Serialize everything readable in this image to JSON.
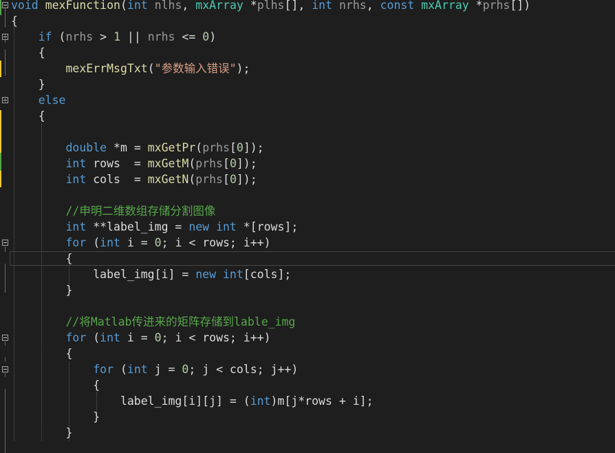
{
  "editor": {
    "colors": {
      "background": "#1e1e1e",
      "keyword": "#569cd6",
      "type": "#4ec9b0",
      "function": "#dcdcaa",
      "parameter": "#9a9a9a",
      "string": "#d69d85",
      "number": "#b5cea8",
      "comment": "#57a64a",
      "text": "#dcdcdc",
      "change_saved": "#57a64a",
      "change_unsaved": "#efc832"
    },
    "lines": [
      {
        "role": "function-signature",
        "tokens": [
          {
            "c": "kw",
            "t": "void"
          },
          {
            "c": "tx",
            "t": " "
          },
          {
            "c": "fn",
            "t": "mexFunction"
          },
          {
            "c": "tx",
            "t": "("
          },
          {
            "c": "kw",
            "t": "int"
          },
          {
            "c": "tx",
            "t": " "
          },
          {
            "c": "pm",
            "t": "nlhs"
          },
          {
            "c": "tx",
            "t": ", "
          },
          {
            "c": "ty",
            "t": "mxArray"
          },
          {
            "c": "tx",
            "t": " *"
          },
          {
            "c": "pm",
            "t": "plhs"
          },
          {
            "c": "tx",
            "t": "[], "
          },
          {
            "c": "kw",
            "t": "int"
          },
          {
            "c": "tx",
            "t": " "
          },
          {
            "c": "pm",
            "t": "nrhs"
          },
          {
            "c": "tx",
            "t": ", "
          },
          {
            "c": "kw",
            "t": "const"
          },
          {
            "c": "tx",
            "t": " "
          },
          {
            "c": "ty",
            "t": "mxArray"
          },
          {
            "c": "tx",
            "t": " *"
          },
          {
            "c": "pm",
            "t": "prhs"
          },
          {
            "c": "tx",
            "t": "[])"
          }
        ]
      },
      {
        "role": "brace",
        "tokens": [
          {
            "c": "tx",
            "t": "{"
          }
        ]
      },
      {
        "role": "if-statement",
        "tokens": [
          {
            "c": "tx",
            "t": "    "
          },
          {
            "c": "kw",
            "t": "if"
          },
          {
            "c": "tx",
            "t": " ("
          },
          {
            "c": "pm",
            "t": "nrhs"
          },
          {
            "c": "tx",
            "t": " > "
          },
          {
            "c": "num",
            "t": "1"
          },
          {
            "c": "tx",
            "t": " || "
          },
          {
            "c": "pm",
            "t": "nrhs"
          },
          {
            "c": "tx",
            "t": " <= "
          },
          {
            "c": "num",
            "t": "0"
          },
          {
            "c": "tx",
            "t": ")"
          }
        ]
      },
      {
        "role": "brace",
        "tokens": [
          {
            "c": "tx",
            "t": "    {"
          }
        ]
      },
      {
        "role": "statement",
        "tokens": [
          {
            "c": "tx",
            "t": "        "
          },
          {
            "c": "fn",
            "t": "mexErrMsgTxt"
          },
          {
            "c": "tx",
            "t": "("
          },
          {
            "c": "str",
            "t": "\"参数输入错误\""
          },
          {
            "c": "tx",
            "t": ");"
          }
        ]
      },
      {
        "role": "brace",
        "tokens": [
          {
            "c": "tx",
            "t": "    }"
          }
        ]
      },
      {
        "role": "else-statement",
        "tokens": [
          {
            "c": "tx",
            "t": "    "
          },
          {
            "c": "kw",
            "t": "else"
          }
        ]
      },
      {
        "role": "brace",
        "tokens": [
          {
            "c": "tx",
            "t": "    {"
          }
        ]
      },
      {
        "role": "blank",
        "tokens": []
      },
      {
        "role": "declaration",
        "tokens": [
          {
            "c": "tx",
            "t": "        "
          },
          {
            "c": "kw",
            "t": "double"
          },
          {
            "c": "tx",
            "t": " *m = "
          },
          {
            "c": "fn",
            "t": "mxGetPr"
          },
          {
            "c": "tx",
            "t": "("
          },
          {
            "c": "pm",
            "t": "prhs"
          },
          {
            "c": "tx",
            "t": "["
          },
          {
            "c": "num",
            "t": "0"
          },
          {
            "c": "tx",
            "t": "]);"
          }
        ]
      },
      {
        "role": "declaration",
        "tokens": [
          {
            "c": "tx",
            "t": "        "
          },
          {
            "c": "kw",
            "t": "int"
          },
          {
            "c": "tx",
            "t": " rows  = "
          },
          {
            "c": "fn",
            "t": "mxGetM"
          },
          {
            "c": "tx",
            "t": "("
          },
          {
            "c": "pm",
            "t": "prhs"
          },
          {
            "c": "tx",
            "t": "["
          },
          {
            "c": "num",
            "t": "0"
          },
          {
            "c": "tx",
            "t": "]);"
          }
        ]
      },
      {
        "role": "declaration",
        "tokens": [
          {
            "c": "tx",
            "t": "        "
          },
          {
            "c": "kw",
            "t": "int"
          },
          {
            "c": "tx",
            "t": " cols  = "
          },
          {
            "c": "fn",
            "t": "mxGetN"
          },
          {
            "c": "tx",
            "t": "("
          },
          {
            "c": "pm",
            "t": "prhs"
          },
          {
            "c": "tx",
            "t": "["
          },
          {
            "c": "num",
            "t": "0"
          },
          {
            "c": "tx",
            "t": "]);"
          }
        ]
      },
      {
        "role": "blank",
        "tokens": []
      },
      {
        "role": "comment",
        "tokens": [
          {
            "c": "tx",
            "t": "        "
          },
          {
            "c": "cm",
            "t": "//申明二维数组存储分割图像"
          }
        ]
      },
      {
        "role": "declaration",
        "tokens": [
          {
            "c": "tx",
            "t": "        "
          },
          {
            "c": "kw",
            "t": "int"
          },
          {
            "c": "tx",
            "t": " **label_img = "
          },
          {
            "c": "kw",
            "t": "new"
          },
          {
            "c": "tx",
            "t": " "
          },
          {
            "c": "kw",
            "t": "int"
          },
          {
            "c": "tx",
            "t": " *[rows];"
          }
        ]
      },
      {
        "role": "for-loop",
        "tokens": [
          {
            "c": "tx",
            "t": "        "
          },
          {
            "c": "kw",
            "t": "for"
          },
          {
            "c": "tx",
            "t": " ("
          },
          {
            "c": "kw",
            "t": "int"
          },
          {
            "c": "tx",
            "t": " i = "
          },
          {
            "c": "num",
            "t": "0"
          },
          {
            "c": "tx",
            "t": "; i < rows; i++)"
          }
        ]
      },
      {
        "role": "brace",
        "tokens": [
          {
            "c": "tx",
            "t": "        {"
          }
        ]
      },
      {
        "role": "statement",
        "tokens": [
          {
            "c": "tx",
            "t": "            label_img[i] = "
          },
          {
            "c": "kw",
            "t": "new"
          },
          {
            "c": "tx",
            "t": " "
          },
          {
            "c": "kw",
            "t": "int"
          },
          {
            "c": "tx",
            "t": "[cols];"
          }
        ]
      },
      {
        "role": "brace",
        "tokens": [
          {
            "c": "tx",
            "t": "        }"
          }
        ]
      },
      {
        "role": "blank",
        "tokens": []
      },
      {
        "role": "comment",
        "tokens": [
          {
            "c": "tx",
            "t": "        "
          },
          {
            "c": "cm",
            "t": "//将Matlab传进来的矩阵存储到lable_img"
          }
        ]
      },
      {
        "role": "for-loop",
        "tokens": [
          {
            "c": "tx",
            "t": "        "
          },
          {
            "c": "kw",
            "t": "for"
          },
          {
            "c": "tx",
            "t": " ("
          },
          {
            "c": "kw",
            "t": "int"
          },
          {
            "c": "tx",
            "t": " i = "
          },
          {
            "c": "num",
            "t": "0"
          },
          {
            "c": "tx",
            "t": "; i < rows; i++)"
          }
        ]
      },
      {
        "role": "brace",
        "tokens": [
          {
            "c": "tx",
            "t": "        {"
          }
        ]
      },
      {
        "role": "for-loop",
        "tokens": [
          {
            "c": "tx",
            "t": "            "
          },
          {
            "c": "kw",
            "t": "for"
          },
          {
            "c": "tx",
            "t": " ("
          },
          {
            "c": "kw",
            "t": "int"
          },
          {
            "c": "tx",
            "t": " j = "
          },
          {
            "c": "num",
            "t": "0"
          },
          {
            "c": "tx",
            "t": "; j < cols; j++)"
          }
        ]
      },
      {
        "role": "brace",
        "tokens": [
          {
            "c": "tx",
            "t": "            {"
          }
        ]
      },
      {
        "role": "statement",
        "tokens": [
          {
            "c": "tx",
            "t": "                label_img[i][j] = ("
          },
          {
            "c": "kw",
            "t": "int"
          },
          {
            "c": "tx",
            "t": ")m[j*rows + i];"
          }
        ]
      },
      {
        "role": "brace",
        "tokens": [
          {
            "c": "tx",
            "t": "            }"
          }
        ]
      },
      {
        "role": "brace",
        "tokens": [
          {
            "c": "tx",
            "t": "        }"
          }
        ]
      },
      {
        "role": "blank",
        "tokens": []
      }
    ],
    "fold_markers": [
      0,
      2,
      6,
      15,
      21,
      23
    ],
    "current_line": 16
  }
}
